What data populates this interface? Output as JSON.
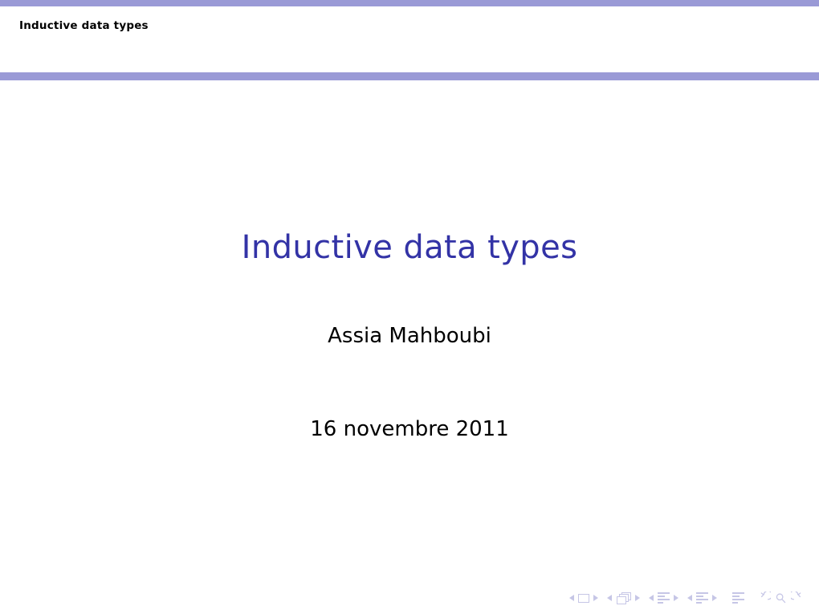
{
  "slide": {
    "header": {
      "title": "Inductive data types",
      "rule_color": "#9a9ad6"
    },
    "titlepage": {
      "title": "Inductive data types",
      "title_color": "#3333a6",
      "author": "Assia Mahboubi",
      "date": "16 novembre 2011"
    },
    "navigation": {
      "color": "#c6c6e6",
      "groups": [
        {
          "name": "slide-navigation",
          "prev_label": "Previous slide",
          "icon": "slide-icon",
          "next_label": "Next slide"
        },
        {
          "name": "frame-navigation",
          "prev_label": "Previous frame",
          "icon": "frames-icon",
          "next_label": "Next frame"
        },
        {
          "name": "subsection-navigation",
          "prev_label": "Previous subsection",
          "icon": "subsection-icon",
          "next_label": "Next subsection"
        },
        {
          "name": "section-navigation",
          "prev_label": "Previous section",
          "icon": "section-icon",
          "next_label": "Next section"
        }
      ],
      "presentation_icon": "document-icon",
      "back_label": "Go back",
      "search_label": "Search",
      "forward_label": "Go forward"
    }
  }
}
